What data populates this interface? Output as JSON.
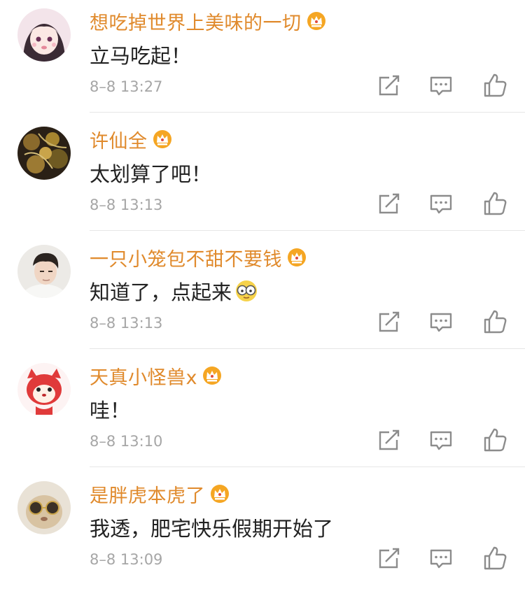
{
  "comments": [
    {
      "username": "想吃掉世界上美味的一切",
      "text": "立马吃起！",
      "time": "8–8 13:27",
      "emoji": null
    },
    {
      "username": "许仙全",
      "text": "太划算了吧！",
      "time": "8–8 13:13",
      "emoji": null
    },
    {
      "username": "一只小笼包不甜不要钱",
      "text": "知道了，点起来",
      "time": "8–8 13:13",
      "emoji": "glasses-face-emoji"
    },
    {
      "username": "天真小怪兽x",
      "text": "哇！",
      "time": "8–8 13:10",
      "emoji": null
    },
    {
      "username": "是胖虎本虎了",
      "text": "我透，肥宅快乐假期开始了",
      "time": "8–8 13:09",
      "emoji": null
    }
  ],
  "colors": {
    "username": "#e08a2c",
    "text": "#222222",
    "time": "#a6a6a6",
    "icon": "#8c8c8c",
    "vip_badge": "#f5a623",
    "divider": "#e6e6e6"
  },
  "icons": {
    "vip": "crown-vip-icon",
    "repost": "repost-icon",
    "reply": "reply-icon",
    "like": "thumbs-up-icon"
  }
}
